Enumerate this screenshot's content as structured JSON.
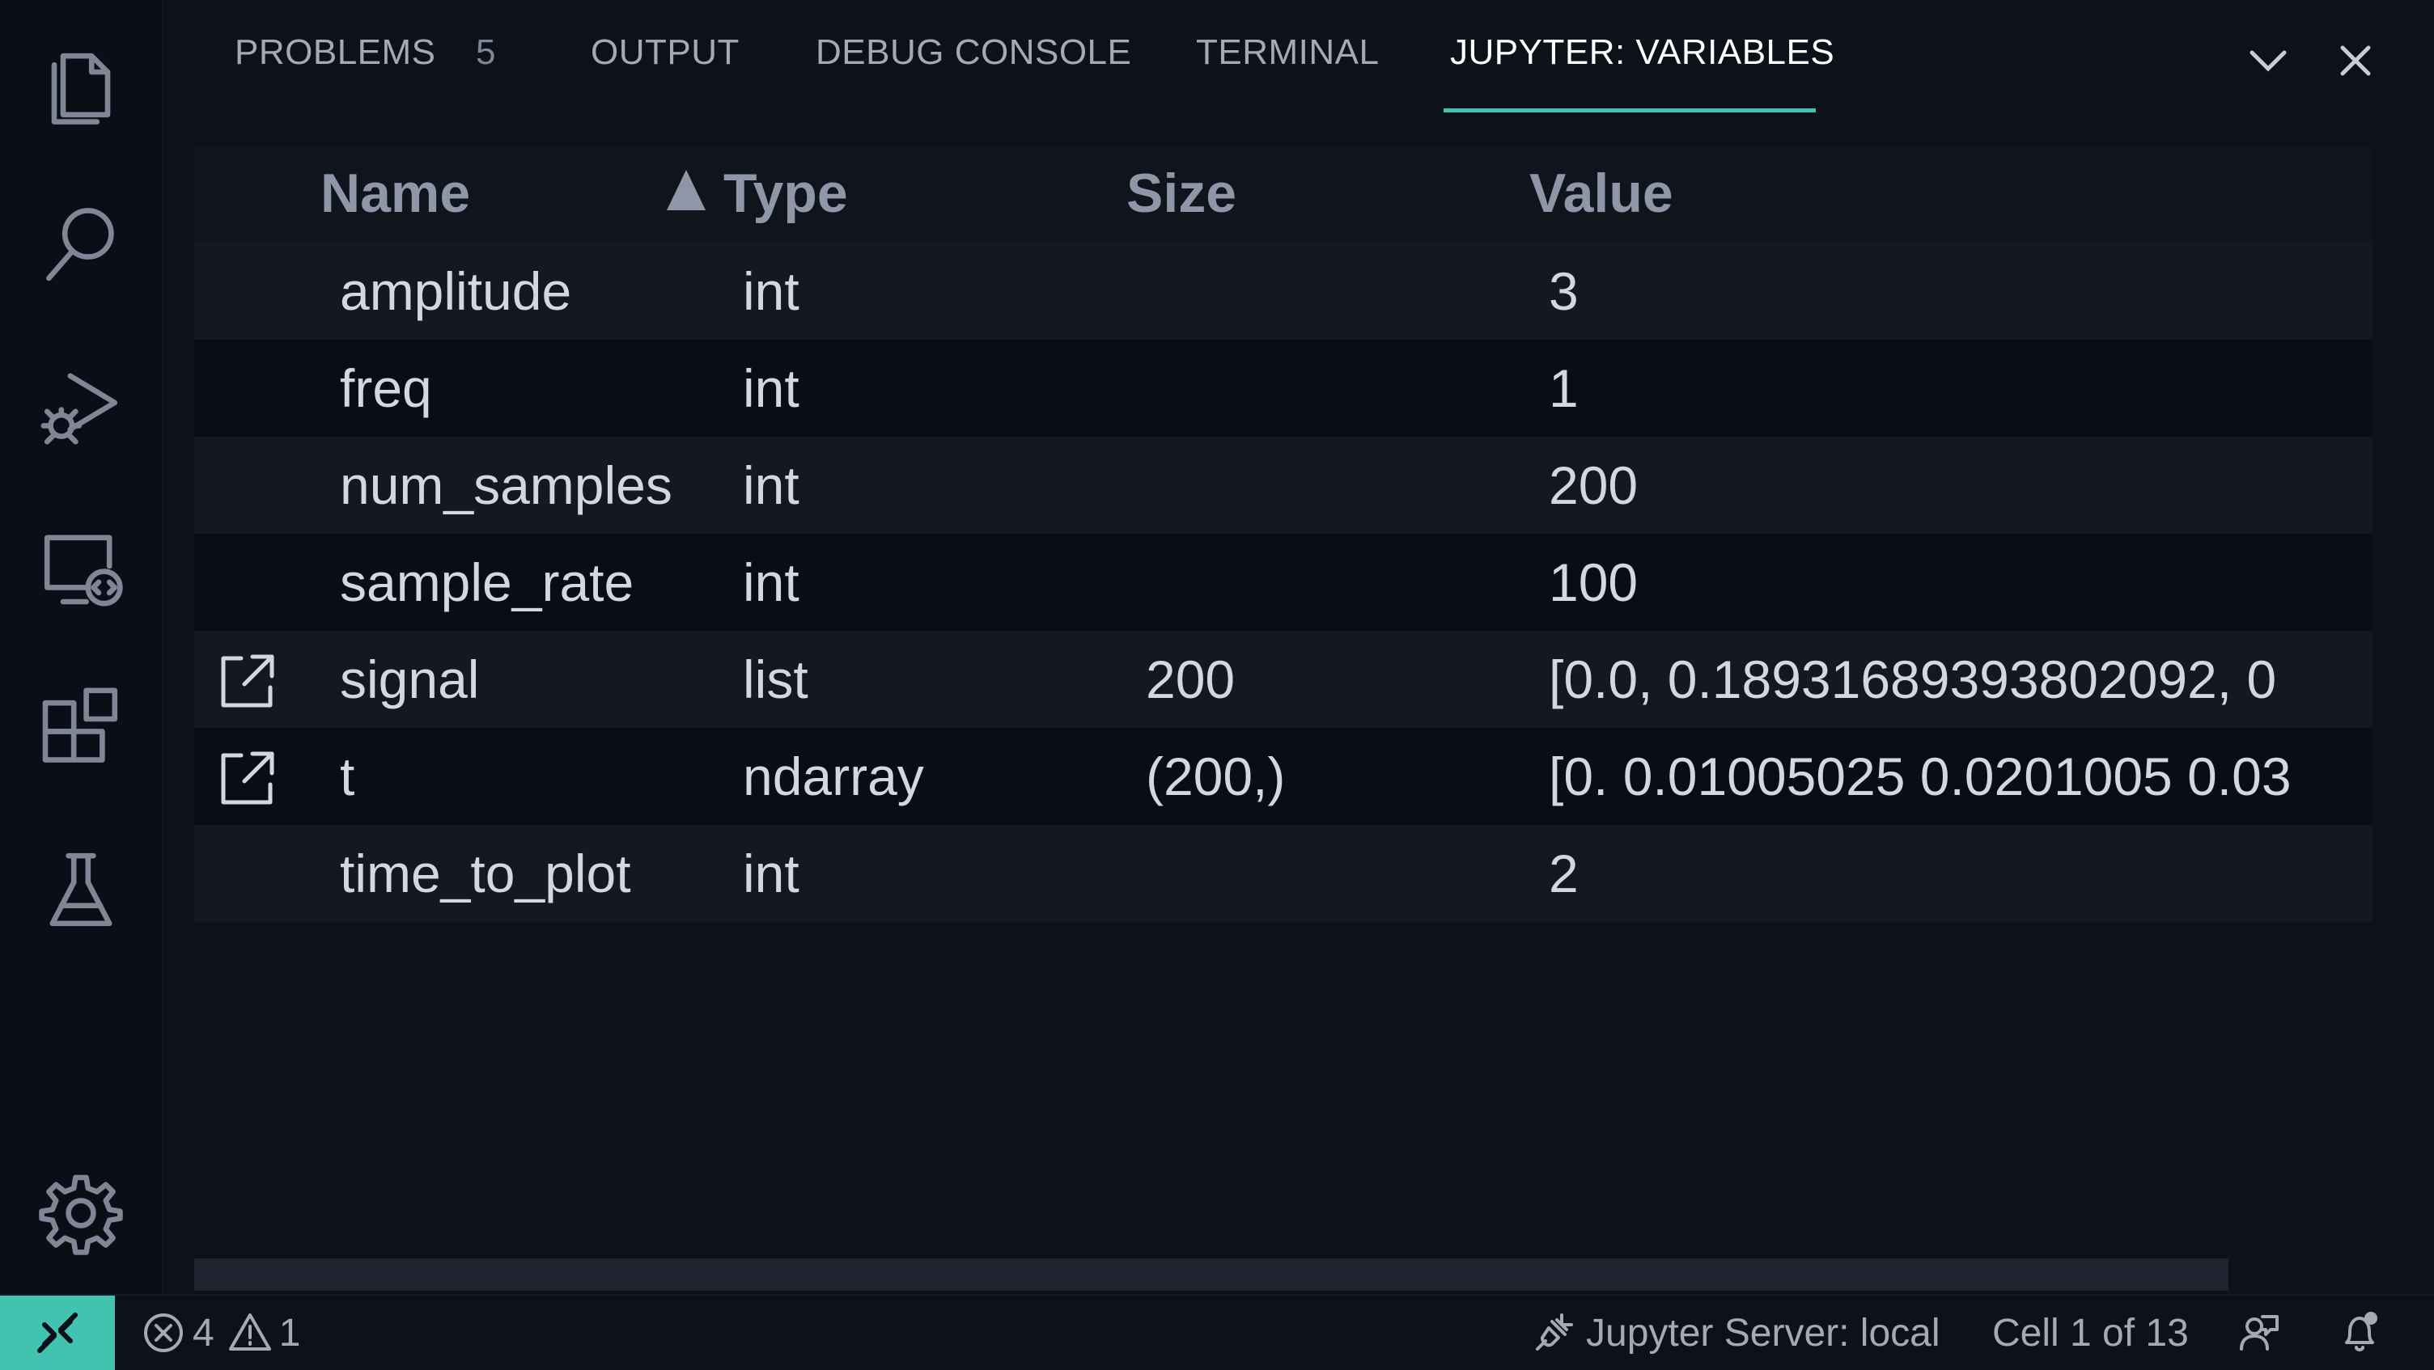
{
  "activity_bar": {
    "items": [
      "explorer-icon",
      "search-icon",
      "run-debug-icon",
      "remote-explorer-icon",
      "extensions-icon",
      "testing-icon"
    ],
    "bottom": [
      "gear-icon"
    ]
  },
  "tabs": {
    "problems": "PROBLEMS",
    "problems_count": "5",
    "output": "OUTPUT",
    "debug_console": "DEBUG CONSOLE",
    "terminal": "TERMINAL",
    "jupyter_variables": "JUPYTER: VARIABLES"
  },
  "accent_color": "#41c3b0",
  "grid": {
    "headers": {
      "name": "Name",
      "type": "Type",
      "size": "Size",
      "value": "Value"
    },
    "sort_column": "Type",
    "rows": [
      {
        "name": "amplitude",
        "type": "int",
        "size": "",
        "value": "3"
      },
      {
        "name": "freq",
        "type": "int",
        "size": "",
        "value": "1"
      },
      {
        "name": "num_samples",
        "type": "int",
        "size": "",
        "value": "200"
      },
      {
        "name": "sample_rate",
        "type": "int",
        "size": "",
        "value": "100"
      },
      {
        "name": "signal",
        "type": "list",
        "size": "200",
        "value": "[0.0, 0.18931689393802092, 0"
      },
      {
        "name": "t",
        "type": "ndarray",
        "size": "(200,)",
        "value": "[0. 0.01005025 0.0201005 0.03"
      },
      {
        "name": "time_to_plot",
        "type": "int",
        "size": "",
        "value": "2"
      }
    ]
  },
  "status_bar": {
    "errors": "4",
    "warnings": "1",
    "jupyter_server": "Jupyter Server: local",
    "cell_position": "Cell 1 of 13"
  }
}
